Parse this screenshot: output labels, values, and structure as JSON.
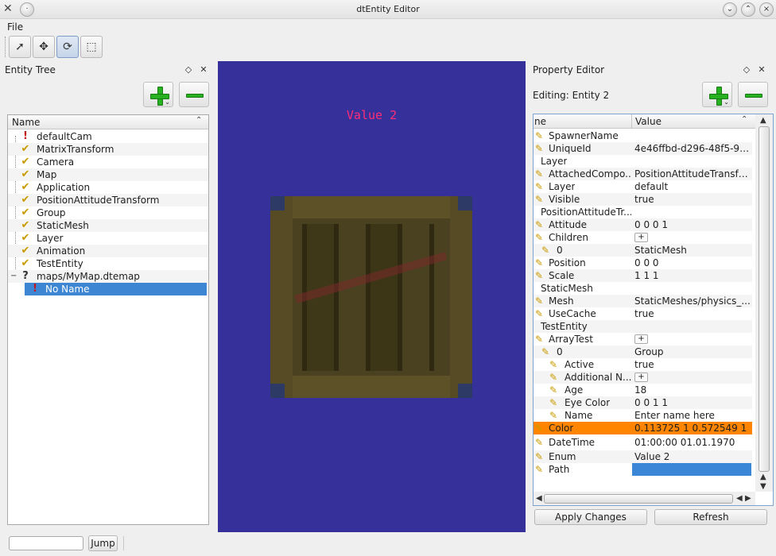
{
  "window": {
    "title": "dtEntity Editor"
  },
  "menu": {
    "file": "File"
  },
  "toolbar": {
    "tools": [
      "select-tool",
      "move-tool",
      "rotate-tool",
      "scale-tool"
    ]
  },
  "entity_tree": {
    "title": "Entity Tree",
    "column": "Name",
    "items": [
      {
        "label": "defaultCam",
        "icon": "warning-icon"
      },
      {
        "label": "MatrixTransform",
        "icon": "check-icon"
      },
      {
        "label": "Camera",
        "icon": "check-icon"
      },
      {
        "label": "Map",
        "icon": "check-icon"
      },
      {
        "label": "Application",
        "icon": "check-icon"
      },
      {
        "label": "PositionAttitudeTransform",
        "icon": "check-icon"
      },
      {
        "label": "Group",
        "icon": "check-icon"
      },
      {
        "label": "StaticMesh",
        "icon": "check-icon"
      },
      {
        "label": "Layer",
        "icon": "check-icon"
      },
      {
        "label": "Animation",
        "icon": "check-icon"
      },
      {
        "label": "TestEntity",
        "icon": "check-icon"
      },
      {
        "label": "maps/MyMap.dtemap",
        "icon": "question-icon"
      },
      {
        "label": "No Name",
        "icon": "warning-icon"
      }
    ]
  },
  "viewport": {
    "label": "Value 2"
  },
  "property_editor": {
    "title": "Property Editor",
    "editing": "Editing: Entity 2",
    "col_name": "ne",
    "col_value": "Value",
    "rows": [
      {
        "name": "SpawnerName",
        "value": ""
      },
      {
        "name": "UniqueId",
        "value": "4e46ffbd-d296-48f5-98..."
      },
      {
        "name": "Layer",
        "value": ""
      },
      {
        "name": "AttachedCompo...",
        "value": "PositionAttitudeTransform"
      },
      {
        "name": "Layer",
        "value": "default"
      },
      {
        "name": "Visible",
        "value": "true"
      },
      {
        "name": "PositionAttitudeTr...",
        "value": ""
      },
      {
        "name": "Attitude",
        "value": "0 0 0 1"
      },
      {
        "name": "Children",
        "value": "+"
      },
      {
        "name": "0",
        "value": "StaticMesh"
      },
      {
        "name": "Position",
        "value": "0 0 0"
      },
      {
        "name": "Scale",
        "value": "1 1 1"
      },
      {
        "name": "StaticMesh",
        "value": ""
      },
      {
        "name": "Mesh",
        "value": "StaticMeshes/physics_..."
      },
      {
        "name": "UseCache",
        "value": "true"
      },
      {
        "name": "TestEntity",
        "value": ""
      },
      {
        "name": "ArrayTest",
        "value": "+"
      },
      {
        "name": "0",
        "value": "Group"
      },
      {
        "name": "Active",
        "value": "true"
      },
      {
        "name": "Additional N...",
        "value": "+"
      },
      {
        "name": "Age",
        "value": "18"
      },
      {
        "name": "Eye Color",
        "value": "0 0 1 1"
      },
      {
        "name": "Name",
        "value": "Enter name here"
      },
      {
        "name": "Color",
        "value": "0.113725 1 0.572549 1"
      },
      {
        "name": "DateTime",
        "value": "01:00:00 01.01.1970"
      },
      {
        "name": "Enum",
        "value": "Value 2"
      },
      {
        "name": "Path",
        "value": ""
      }
    ],
    "apply": "Apply Changes",
    "refresh": "Refresh"
  },
  "bottom": {
    "jump": "Jump",
    "jump_value": ""
  }
}
